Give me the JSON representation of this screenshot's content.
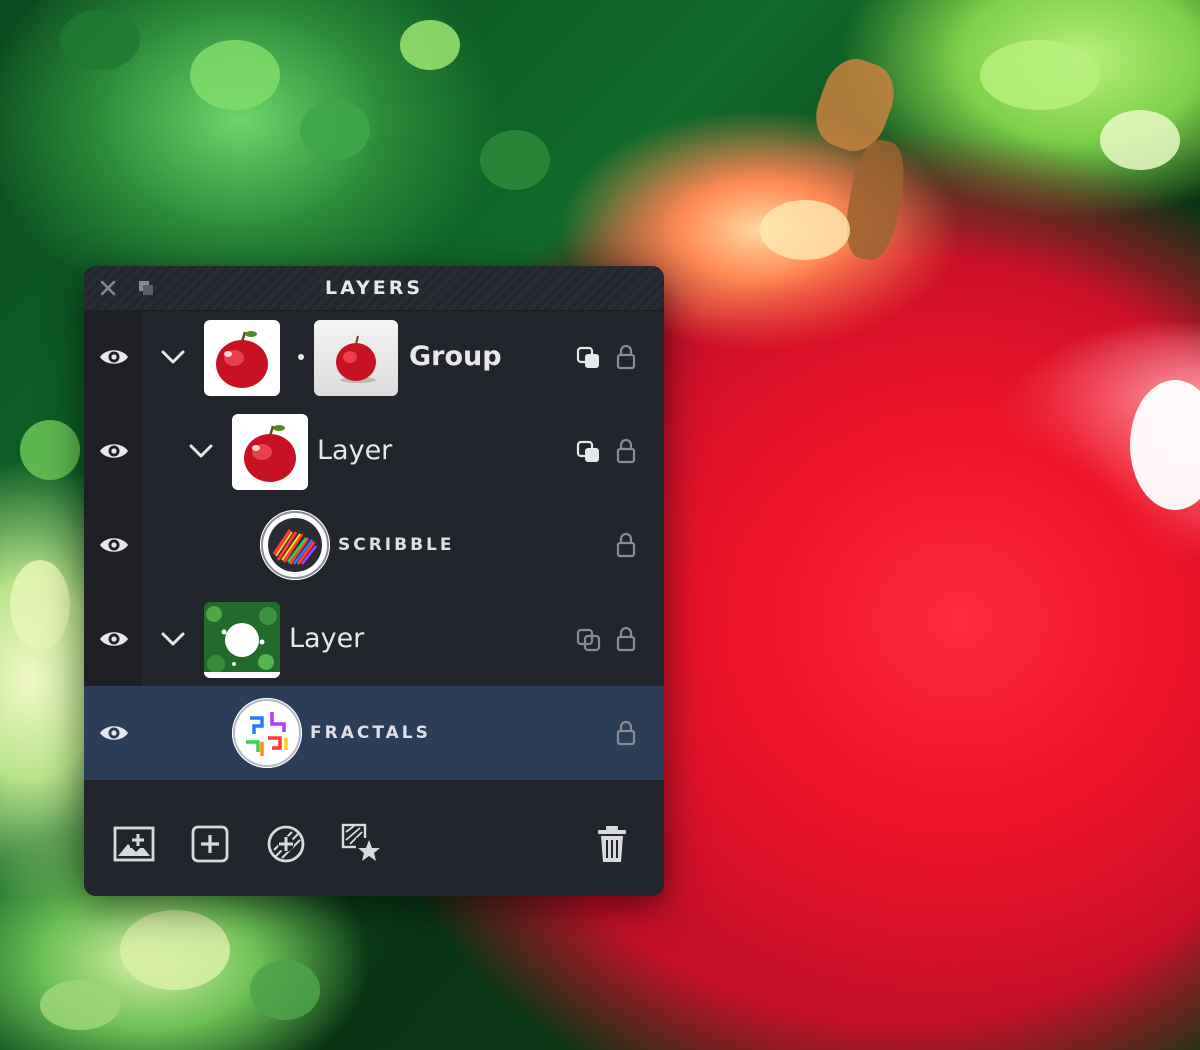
{
  "panel": {
    "title": "LAYERS",
    "close_icon": "close-icon",
    "dock_icon": "dock-icon"
  },
  "layers": [
    {
      "name": "Group",
      "kind": "group",
      "visible": true,
      "expanded": true,
      "selected": false,
      "mask_icon": "mask-linked-icon",
      "locked": false
    },
    {
      "name": "Layer",
      "kind": "image",
      "visible": true,
      "expanded": true,
      "selected": false,
      "mask_icon": "mask-linked-icon",
      "locked": false
    },
    {
      "name": "SCRIBBLE",
      "kind": "effect",
      "visible": true,
      "selected": false,
      "locked": false
    },
    {
      "name": "Layer",
      "kind": "image",
      "visible": true,
      "expanded": true,
      "selected": false,
      "mask_icon": "mask-unlinked-icon",
      "locked": false
    },
    {
      "name": "FRACTALS",
      "kind": "effect",
      "visible": true,
      "selected": true,
      "locked": false
    }
  ],
  "toolbar": {
    "buttons": [
      "add-image-layer-icon",
      "add-layer-icon",
      "add-effect-icon",
      "add-favorite-effect-icon",
      "trash-icon"
    ]
  },
  "colors": {
    "panel_bg": "#23252c",
    "gutter_bg": "#1e2025",
    "selected_bg": "#2b3d57",
    "text": "#e8e8ec",
    "icon": "#d9dae0"
  }
}
